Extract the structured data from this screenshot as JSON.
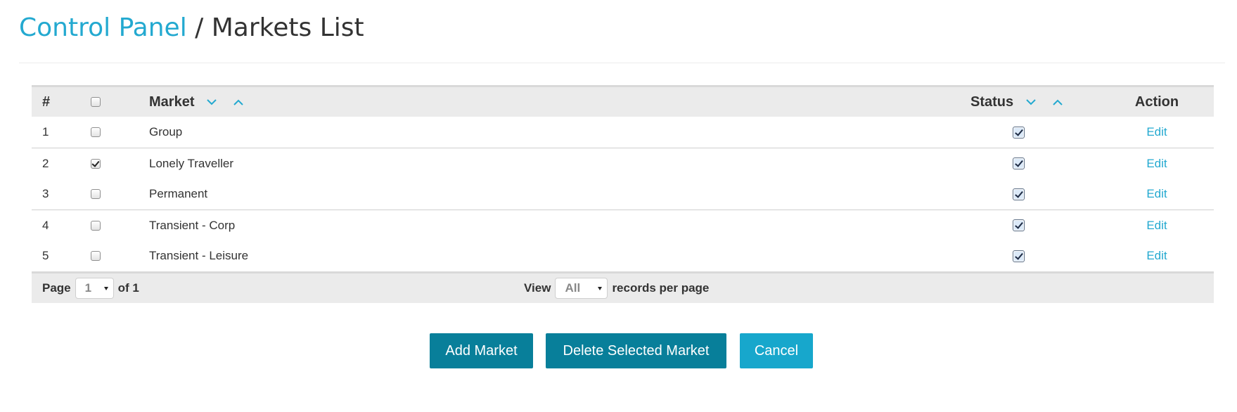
{
  "breadcrumb": {
    "link_label": "Control Panel",
    "separator": "/",
    "current": "Markets List"
  },
  "table": {
    "columns": {
      "num": "#",
      "market": "Market",
      "status": "Status",
      "action": "Action"
    },
    "rows": [
      {
        "num": "1",
        "name": "Group",
        "selected": false,
        "status": true,
        "action": "Edit"
      },
      {
        "num": "2",
        "name": "Lonely Traveller",
        "selected": true,
        "status": true,
        "action": "Edit"
      },
      {
        "num": "3",
        "name": "Permanent",
        "selected": false,
        "status": true,
        "action": "Edit"
      },
      {
        "num": "4",
        "name": "Transient - Corp",
        "selected": false,
        "status": true,
        "action": "Edit"
      },
      {
        "num": "5",
        "name": "Transient - Leisure",
        "selected": false,
        "status": true,
        "action": "Edit"
      }
    ]
  },
  "pager": {
    "page_label": "Page",
    "page_value": "1",
    "of_label": "of 1",
    "view_label": "View",
    "view_value": "All",
    "records_label": "records per page"
  },
  "buttons": {
    "add": "Add Market",
    "delete": "Delete Selected Market",
    "cancel": "Cancel"
  },
  "colors": {
    "accent": "#23a9d0",
    "primary_button": "#087f9a",
    "cancel_button": "#17a7cc",
    "header_bg": "#ebebeb"
  },
  "icons": {
    "sort_desc": "chevron-down-icon",
    "sort_asc": "chevron-up-icon",
    "select_caret": "caret-down-icon"
  }
}
